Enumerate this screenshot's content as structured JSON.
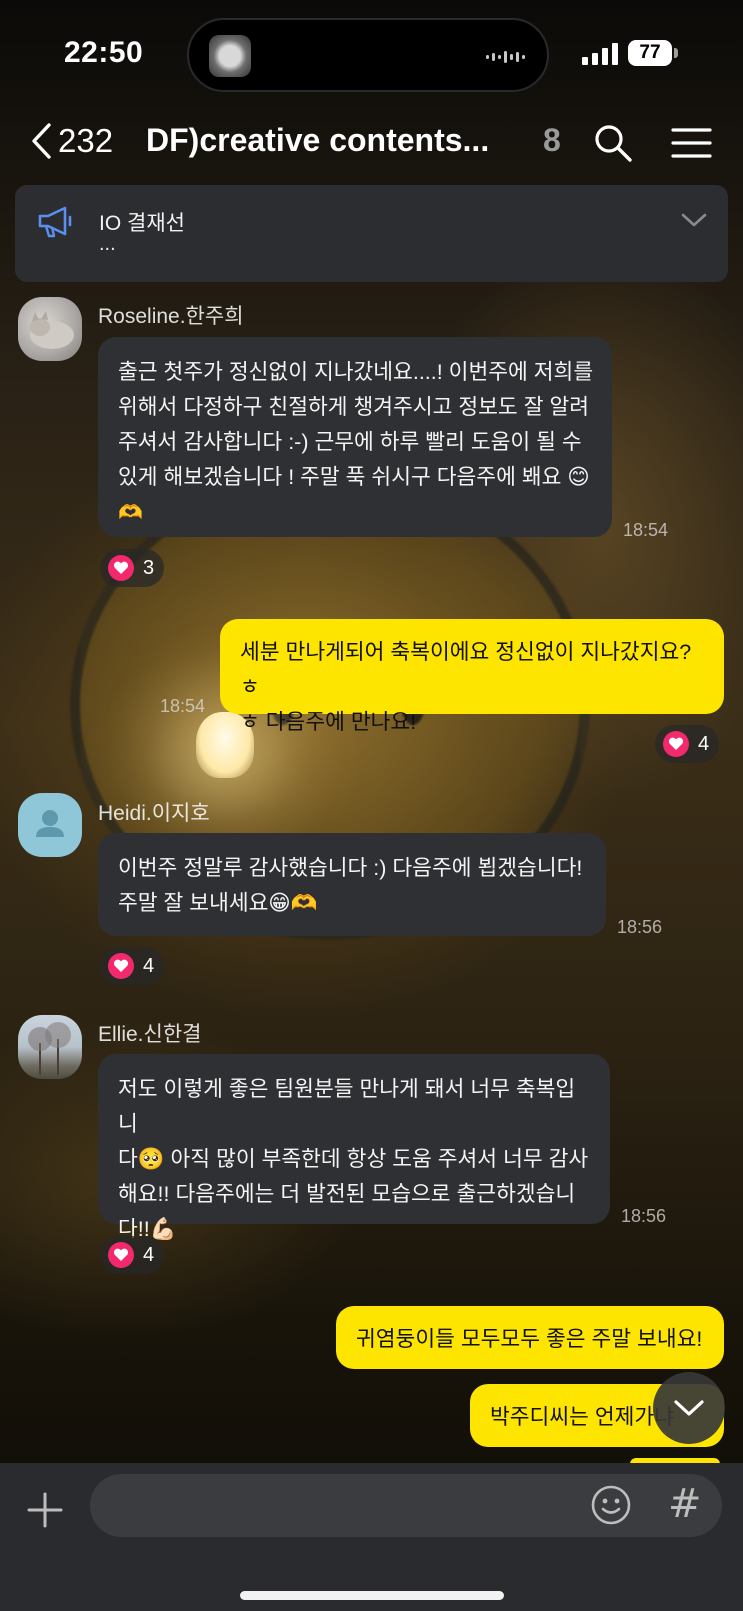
{
  "status_bar": {
    "time": "22:50",
    "battery": "77"
  },
  "header": {
    "back_count": "232",
    "title": "DF)creative contents...",
    "member_count": "8"
  },
  "notice": {
    "title": "IO 결재선",
    "subtitle": "..."
  },
  "messages": [
    {
      "sender": "Roseline.한주희",
      "lines": [
        "출근 첫주가 정신없이 지나갔네요....! 이번주에 저희를",
        "위해서 다정하구 친절하게 챙겨주시고 정보도 잘 알려",
        "주셔서 감사합니다 :-) 근무에 하루 빨리 도움이 될 수",
        "있게 해보겠습니다 ! 주말 푹 쉬시구 다음주에 봬요 😊",
        "🫶"
      ],
      "time": "18:54",
      "reaction_count": "3"
    },
    {
      "mine": true,
      "lines": [
        "세분 만나게되어 축복이에요 정신없이 지나갔지요?ㅎ",
        "ㅎ 다음주에 만나요!"
      ],
      "time": "18:54",
      "reaction_count": "4"
    },
    {
      "sender": "Heidi.이지호",
      "lines": [
        "이번주 정말루 감사했습니다 :) 다음주에 뵙겠습니다!",
        "주말 잘 보내세요😁🫶"
      ],
      "time": "18:56",
      "reaction_count": "4"
    },
    {
      "sender": "Ellie.신한결",
      "lines": [
        "저도 이렇게 좋은 팀원분들 만나게 돼서 너무 축복입니",
        "다🥺 아직 많이 부족한데 항상 도움 주셔서 너무 감사",
        "해요!! 다음주에는 더 발전된 모습으로 출근하겠습니",
        "다!!💪🏻"
      ],
      "time": "18:56",
      "reaction_count": "4"
    },
    {
      "mine": true,
      "lines": [
        "귀염둥이들 모두모두 좋은 주말 보내요!"
      ]
    },
    {
      "mine": true,
      "lines": [
        "박주디씨는 언제가냐"
      ]
    }
  ],
  "input": {
    "placeholder": ""
  },
  "icons": {
    "back": "chevron-left-icon",
    "search": "search-icon",
    "menu": "menu-icon",
    "notice": "megaphone-icon",
    "notice_toggle": "chevron-down-icon",
    "reaction": "heart-icon",
    "scroll": "chevron-down-icon",
    "attach": "plus-icon",
    "emoticon": "smiley-icon",
    "hashtag": "hash-icon"
  },
  "colors": {
    "my_bubble": "#fee500",
    "other_bubble": "#2f3033",
    "heart": "#f2296d"
  }
}
